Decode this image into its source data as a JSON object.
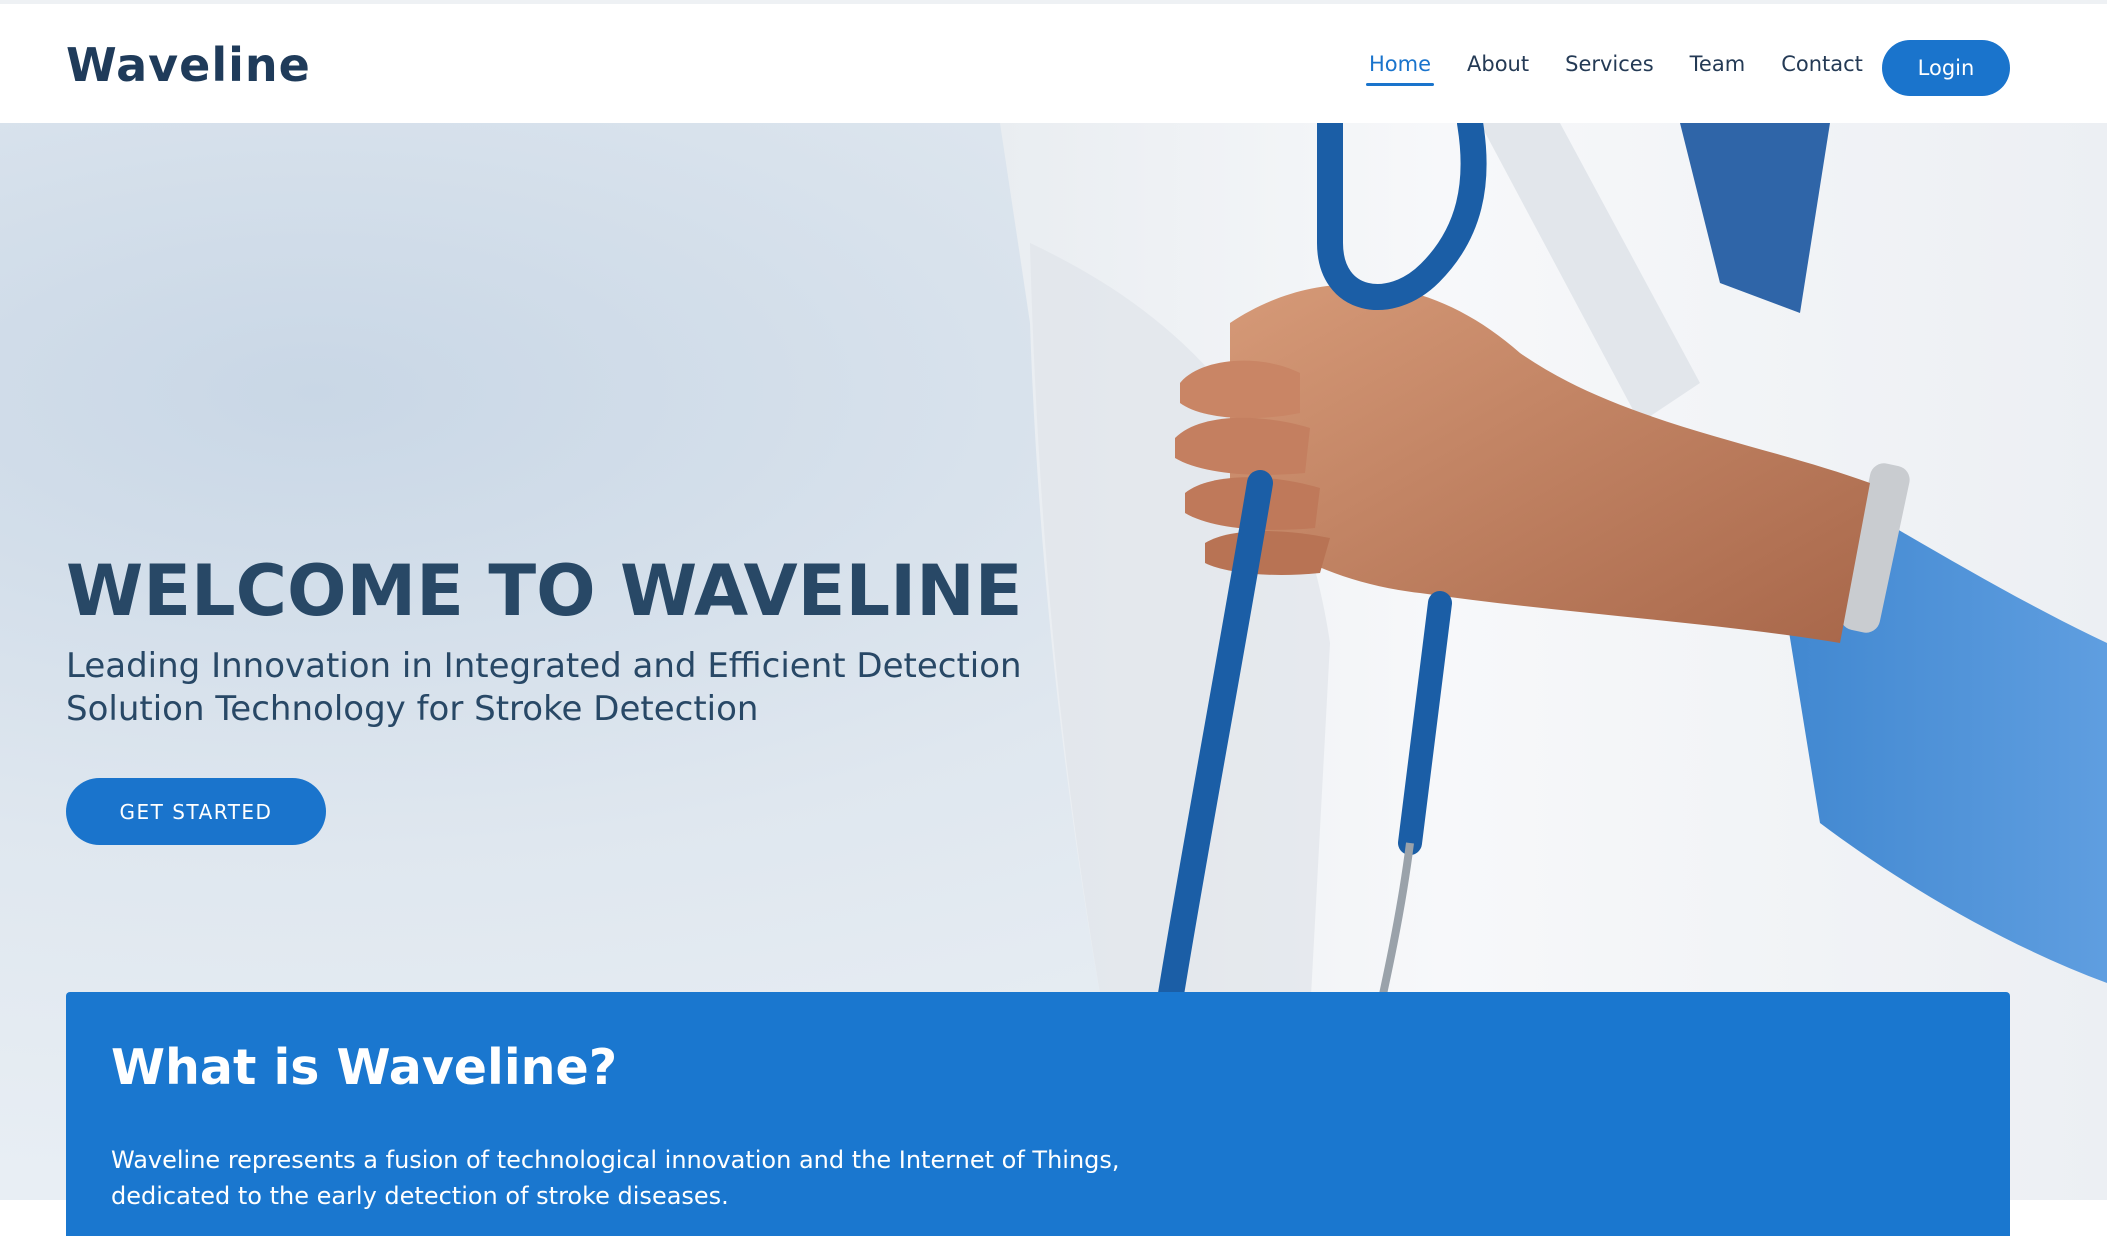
{
  "header": {
    "logo": "Waveline",
    "nav": [
      {
        "label": "Home",
        "active": true
      },
      {
        "label": "About",
        "active": false
      },
      {
        "label": "Services",
        "active": false
      },
      {
        "label": "Team",
        "active": false
      },
      {
        "label": "Contact",
        "active": false
      }
    ],
    "login_label": "Login"
  },
  "hero": {
    "title": "WELCOME TO WAVELINE",
    "subtitle_line1": "Leading Innovation in Integrated and Efficient Detection",
    "subtitle_line2": "Solution Technology for Stroke Detection",
    "cta_label": "GET STARTED"
  },
  "info": {
    "title": "What is Waveline?",
    "text_line1": "Waveline represents a fusion of technological innovation and the Internet of Things,",
    "text_line2": "dedicated to the early detection of stroke diseases."
  },
  "colors": {
    "accent": "#1a74cc",
    "heading": "#284866",
    "info_bg": "#1a77cf"
  },
  "icons": [
    "doctor-photo"
  ]
}
